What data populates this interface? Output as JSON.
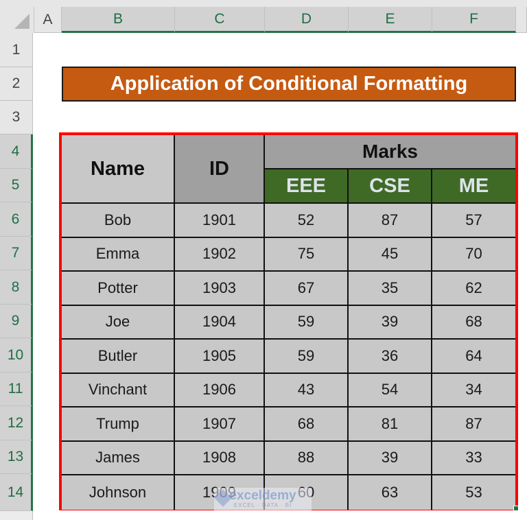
{
  "sheet": {
    "columns": [
      "A",
      "B",
      "C",
      "D",
      "E",
      "F"
    ],
    "rows": [
      "1",
      "2",
      "3",
      "4",
      "5",
      "6",
      "7",
      "8",
      "9",
      "10",
      "11",
      "12",
      "13",
      "14"
    ],
    "selected_columns": [
      "B",
      "C",
      "D",
      "E",
      "F"
    ],
    "selected_rows": [
      "4",
      "5",
      "6",
      "7",
      "8",
      "9",
      "10",
      "11",
      "12",
      "13",
      "14"
    ]
  },
  "title": "Application of Conditional Formatting",
  "table": {
    "header": {
      "name": "Name",
      "id": "ID",
      "marks": "Marks",
      "subjects": [
        "EEE",
        "CSE",
        "ME"
      ]
    },
    "rows": [
      {
        "name": "Bob",
        "id": "1901",
        "eee": "52",
        "cse": "87",
        "me": "57"
      },
      {
        "name": "Emma",
        "id": "1902",
        "eee": "75",
        "cse": "45",
        "me": "70"
      },
      {
        "name": "Potter",
        "id": "1903",
        "eee": "67",
        "cse": "35",
        "me": "62"
      },
      {
        "name": "Joe",
        "id": "1904",
        "eee": "59",
        "cse": "39",
        "me": "68"
      },
      {
        "name": "Butler",
        "id": "1905",
        "eee": "59",
        "cse": "36",
        "me": "64"
      },
      {
        "name": "Vinchant",
        "id": "1906",
        "eee": "43",
        "cse": "54",
        "me": "34"
      },
      {
        "name": "Trump",
        "id": "1907",
        "eee": "68",
        "cse": "81",
        "me": "87"
      },
      {
        "name": "James",
        "id": "1908",
        "eee": "88",
        "cse": "39",
        "me": "33"
      },
      {
        "name": "Johnson",
        "id": "1909",
        "eee": "60",
        "cse": "63",
        "me": "53"
      }
    ]
  },
  "colors": {
    "title_bg": "#c55a11",
    "subject_header_bg": "#3f6a26",
    "selection_border": "#ff0000",
    "excel_green": "#217346"
  },
  "watermark": {
    "main": "exceldemy",
    "sub": "EXCEL · DATA · BI"
  }
}
